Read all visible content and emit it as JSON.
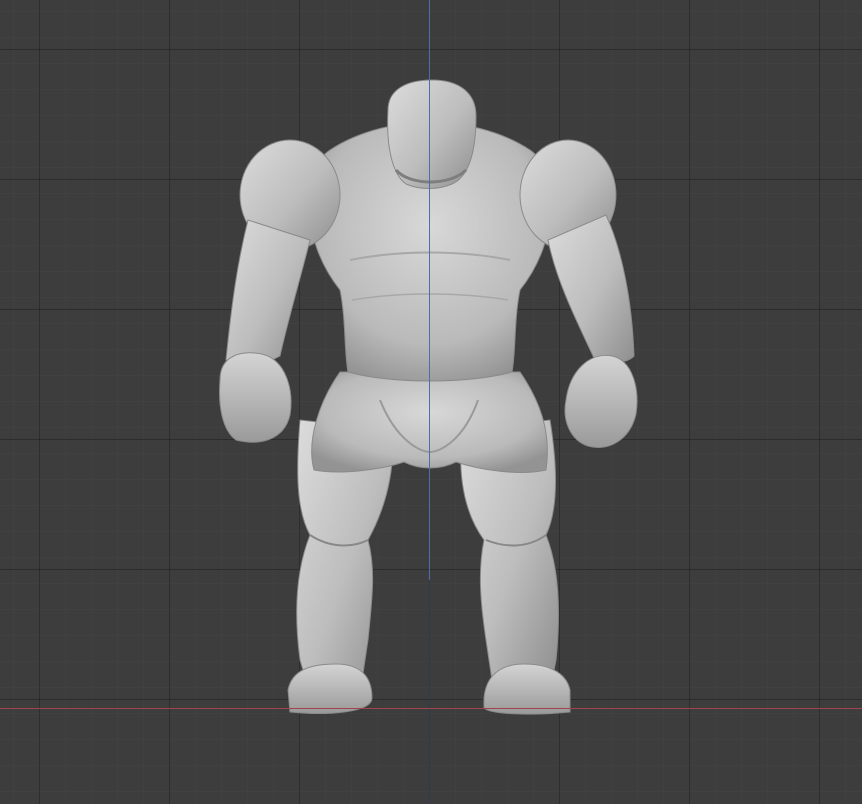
{
  "viewport": {
    "background_color": "#3d3d3d",
    "grid_minor_color": "#464646",
    "grid_major_color": "#2f2f2f",
    "x_axis_color": "#a2434e",
    "z_axis_color": "#4a6fb0"
  },
  "model": {
    "kind": "low-poly humanoid figure",
    "material_color": "#bdbdbd",
    "shade_light": "#d9d9d9",
    "shade_dark": "#8e8e8e"
  }
}
